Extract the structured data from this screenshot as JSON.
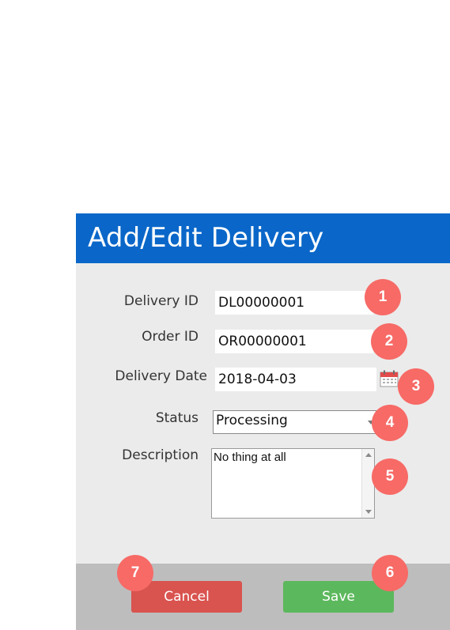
{
  "dialog": {
    "title": "Add/Edit Delivery",
    "fields": {
      "delivery_id": {
        "label": "Delivery ID",
        "value": "DL00000001"
      },
      "order_id": {
        "label": "Order ID",
        "value": "OR00000001"
      },
      "delivery_date": {
        "label": "Delivery Date",
        "value": "2018-04-03"
      },
      "status": {
        "label": "Status",
        "value": "Processing"
      },
      "description": {
        "label": "Description",
        "value": "No thing at all"
      }
    },
    "buttons": {
      "cancel": "Cancel",
      "save": "Save"
    }
  },
  "badges": [
    "1",
    "2",
    "3",
    "4",
    "5",
    "6",
    "7"
  ],
  "colors": {
    "titlebar": "#0a67c9",
    "body": "#ebebeb",
    "footer": "#bdbdbd",
    "cancel": "#d9534f",
    "save": "#5cb85c",
    "badge": "#f76a66"
  },
  "icons": {
    "date_picker": "calendar-icon",
    "status_dropdown": "chevron-down-icon"
  }
}
